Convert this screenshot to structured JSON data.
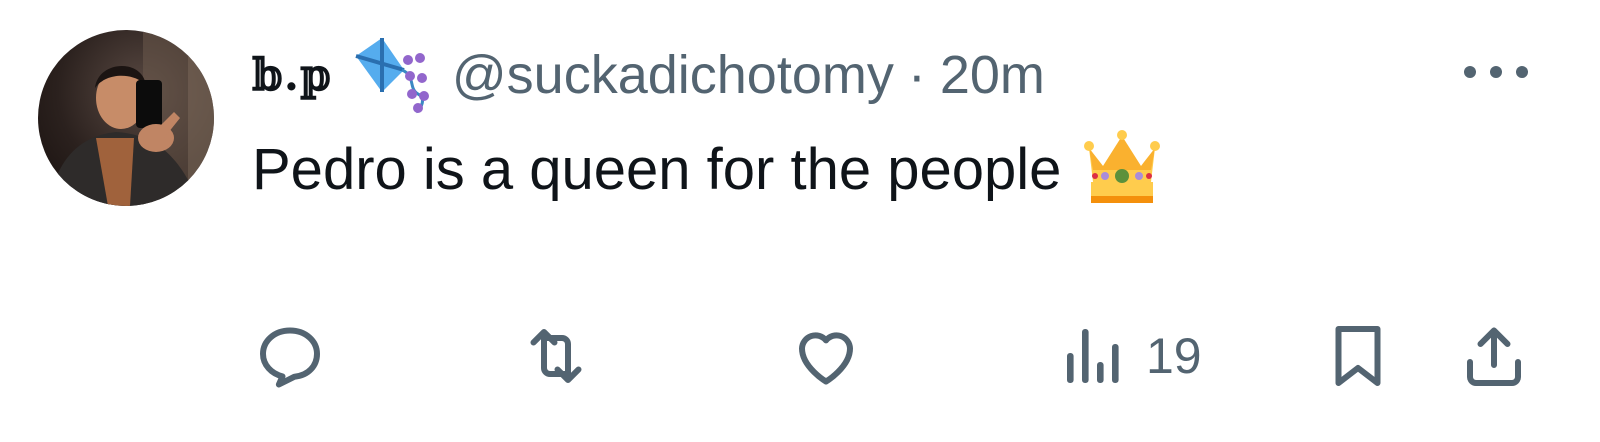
{
  "tweet": {
    "display_name": "𝕓.𝕡",
    "handle": "@suckadichotomy",
    "separator": "·",
    "time": "20m",
    "text": "Pedro is a queen for the people",
    "emoji_after_name": "kite-emoji",
    "emoji_after_text": "crown-emoji"
  },
  "actions": {
    "reply": {
      "icon": "reply-icon",
      "count": ""
    },
    "retweet": {
      "icon": "retweet-icon",
      "count": ""
    },
    "like": {
      "icon": "heart-icon",
      "count": ""
    },
    "views": {
      "icon": "views-icon",
      "count": "19"
    },
    "bookmark": {
      "icon": "bookmark-icon"
    },
    "share": {
      "icon": "share-icon"
    }
  },
  "colors": {
    "text": "#0f1419",
    "muted": "#536471"
  }
}
